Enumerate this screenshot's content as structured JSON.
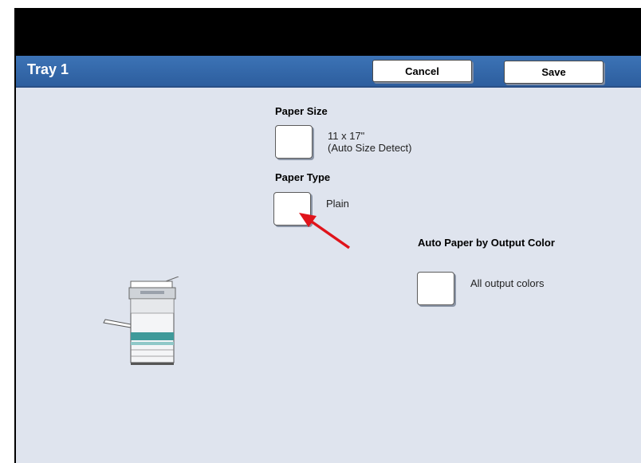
{
  "header": {
    "title": "Tray 1",
    "cancel_label": "Cancel",
    "save_label": "Save"
  },
  "paper_size": {
    "label": "Paper Size",
    "value_line1": "11 x 17\"",
    "value_line2": "(Auto Size Detect)"
  },
  "paper_type": {
    "label": "Paper Type",
    "value": "Plain"
  },
  "auto_paper": {
    "label": "Auto Paper by Output Color",
    "value": "All output colors"
  },
  "colors": {
    "title_bar": "#2d5e9e",
    "background": "#dfe4ee",
    "arrow": "#e0141b"
  }
}
